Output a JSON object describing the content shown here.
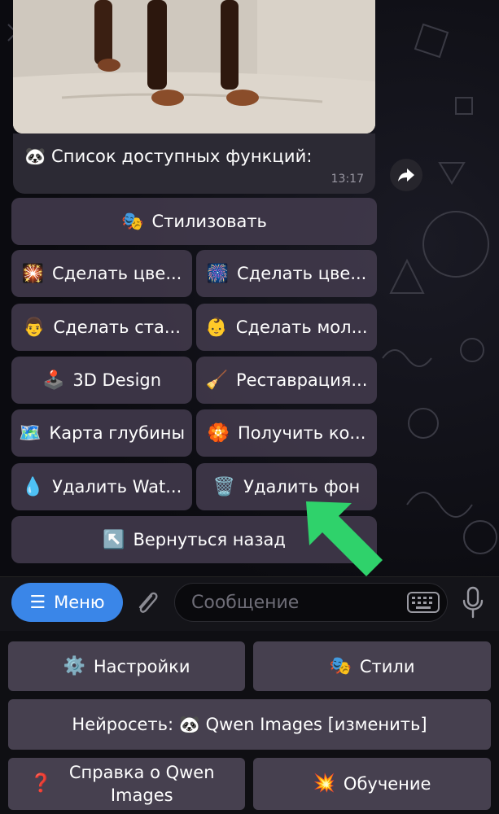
{
  "message": {
    "text": "🐼 Список доступных функций:",
    "time": "13:17"
  },
  "inline_buttons": [
    {
      "emoji": "🎭",
      "label": "Стилизовать"
    },
    {
      "emoji": "🎇",
      "label": "Сделать цве..."
    },
    {
      "emoji": "🎆",
      "label": "Сделать цве..."
    },
    {
      "emoji": "👨",
      "label": "Сделать ста..."
    },
    {
      "emoji": "👶",
      "label": "Сделать мол..."
    },
    {
      "emoji": "🕹️",
      "label": "3D Design"
    },
    {
      "emoji": "🧹",
      "label": "Реставрация..."
    },
    {
      "emoji": "🗺️",
      "label": "Карта глубины"
    },
    {
      "emoji": "🏵️",
      "label": "Получить ко..."
    },
    {
      "emoji": "💧",
      "label": "Удалить Wat..."
    },
    {
      "emoji": "🗑️",
      "label": "Удалить фон"
    },
    {
      "emoji": "↖️",
      "label": "Вернуться назад"
    }
  ],
  "input_bar": {
    "menu_label": "Меню",
    "placeholder": "Сообщение"
  },
  "reply_keyboard": [
    {
      "emoji": "⚙️",
      "label": "Настройки"
    },
    {
      "emoji": "🎭",
      "label": "Стили"
    },
    {
      "emoji": "",
      "label": "Нейросеть: 🐼 Qwen Images [изменить]"
    },
    {
      "emoji": "❓",
      "label": "Справка о Qwen Images"
    },
    {
      "emoji": "💥",
      "label": "Обучение"
    }
  ],
  "colors": {
    "accent": "#3a86e8",
    "highlight_arrow": "#2fd26b",
    "inline_button_bg": "#423a4c",
    "reply_button_bg": "#46404f"
  }
}
